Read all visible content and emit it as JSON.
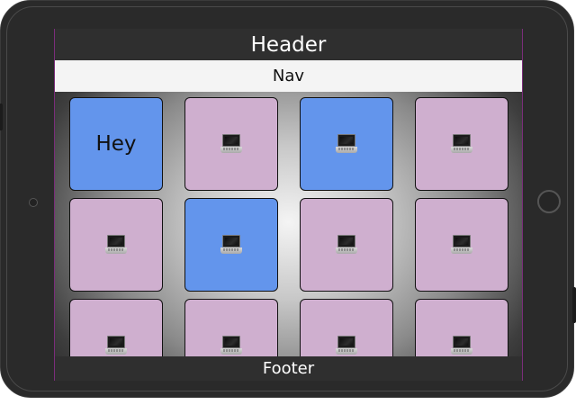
{
  "header": {
    "title": "Header"
  },
  "nav": {
    "label": "Nav"
  },
  "footer": {
    "label": "Footer"
  },
  "colors": {
    "pink_tile": "#cfafcf",
    "blue_tile": "#6395ec",
    "bar": "#2f2f2f",
    "nav_bar": "#f4f4f4"
  },
  "tiles": [
    {
      "color": "blue",
      "text": "Hey",
      "icon": ""
    },
    {
      "color": "pink",
      "text": "",
      "icon": "laptop-icon"
    },
    {
      "color": "blue",
      "text": "",
      "icon": "laptop-icon"
    },
    {
      "color": "pink",
      "text": "",
      "icon": "laptop-icon"
    },
    {
      "color": "pink",
      "text": "",
      "icon": "laptop-icon"
    },
    {
      "color": "blue",
      "text": "",
      "icon": "laptop-icon"
    },
    {
      "color": "pink",
      "text": "",
      "icon": "laptop-icon"
    },
    {
      "color": "pink",
      "text": "",
      "icon": "laptop-icon"
    },
    {
      "color": "pink",
      "text": "",
      "icon": "laptop-icon"
    },
    {
      "color": "pink",
      "text": "",
      "icon": "laptop-icon"
    },
    {
      "color": "pink",
      "text": "",
      "icon": "laptop-icon"
    },
    {
      "color": "pink",
      "text": "",
      "icon": "laptop-icon"
    }
  ]
}
